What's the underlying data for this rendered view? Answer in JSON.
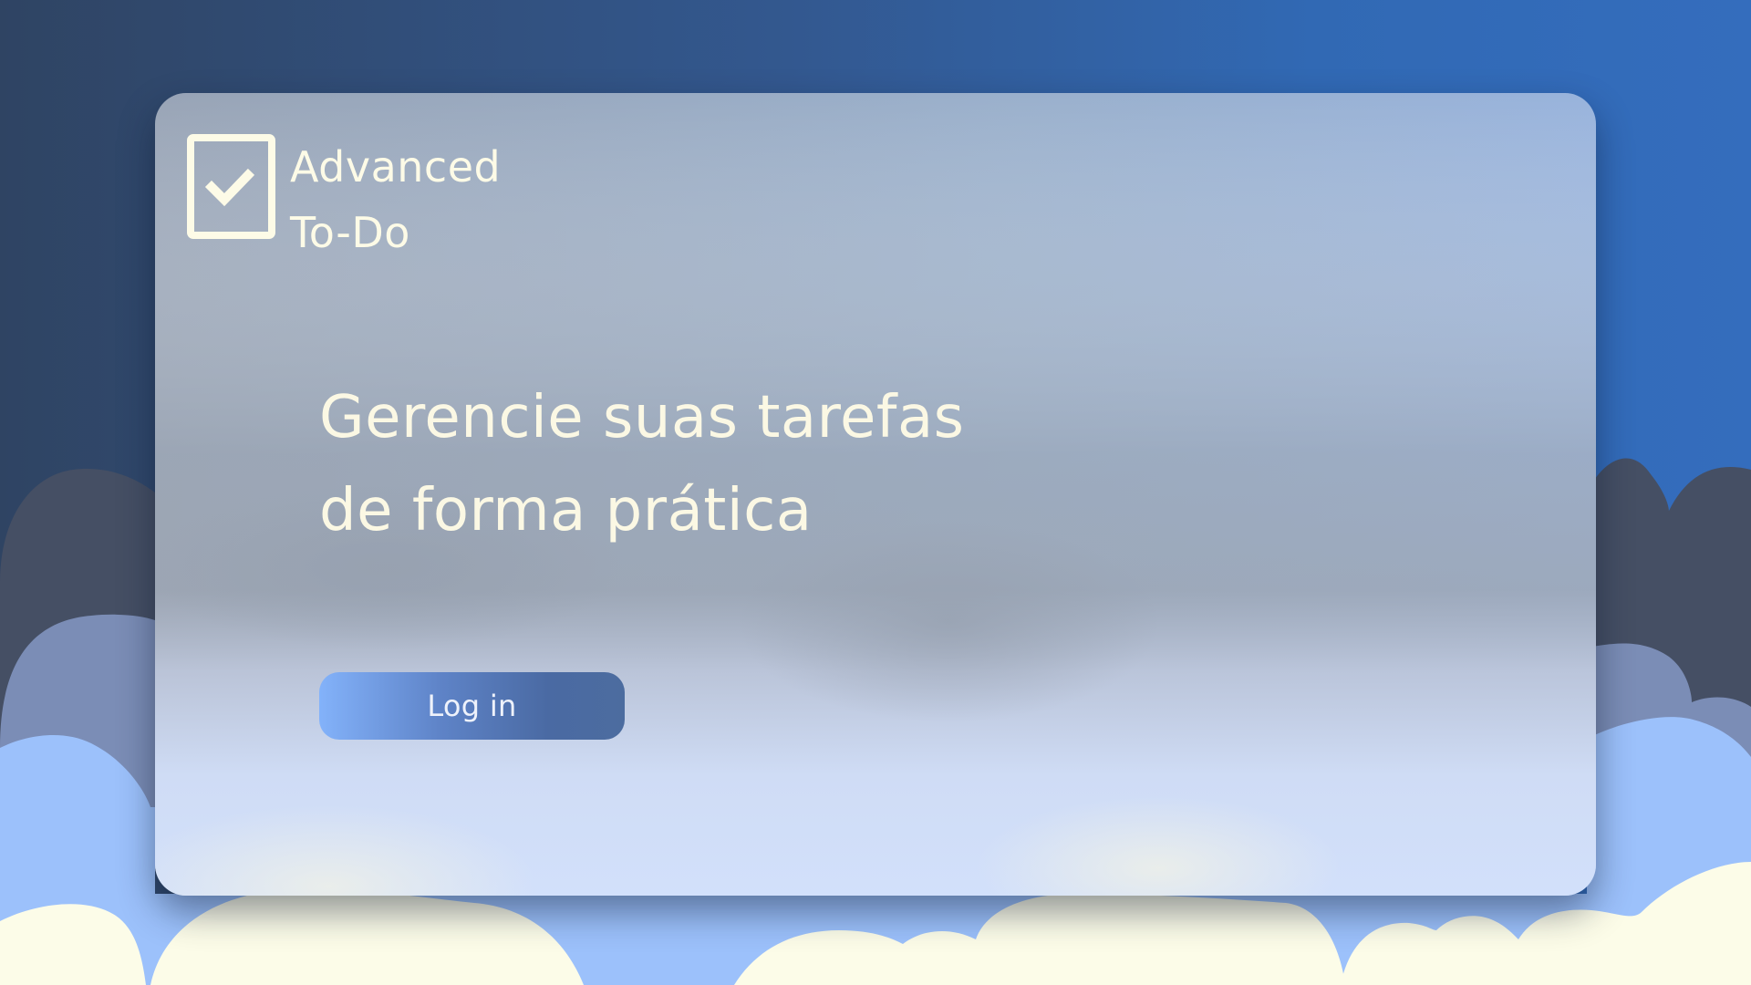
{
  "app": {
    "logo_icon": "checkbox-check-icon",
    "logo_line1": "Advanced",
    "logo_line2": "To-Do"
  },
  "hero": {
    "headline_line1": "Gerencie suas tarefas",
    "headline_line2": "de forma prática"
  },
  "actions": {
    "login_label": "Log in"
  },
  "colors": {
    "background_dark": "#2f4463",
    "background_blue": "#3169b4",
    "cloud_gray": "#454f64",
    "cloud_slate": "#7b8db6",
    "cloud_blue": "#9cc1fb",
    "cloud_cream": "#fcfce8",
    "text_cream": "#fdfbe7",
    "button_start": "#83b2fa",
    "button_end": "#4c6c9f"
  }
}
